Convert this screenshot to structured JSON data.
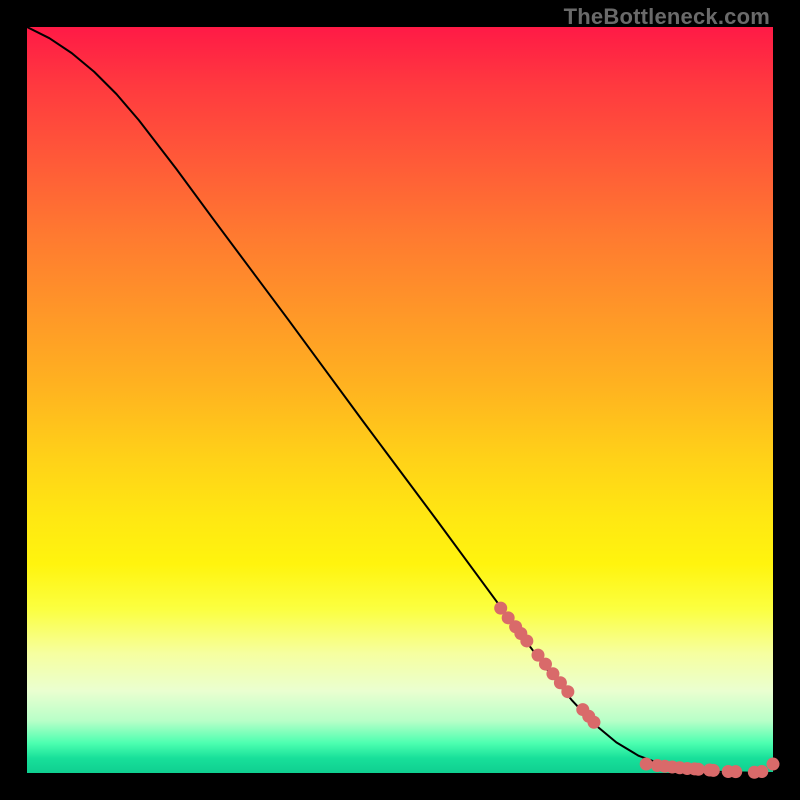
{
  "watermark": "TheBottleneck.com",
  "chart_data": {
    "type": "line",
    "title": "",
    "xlabel": "",
    "ylabel": "",
    "xlim": [
      0,
      100
    ],
    "ylim": [
      0,
      100
    ],
    "grid": false,
    "legend": false,
    "series": [
      {
        "name": "curve",
        "style": "line",
        "color": "#000000",
        "x": [
          0,
          3,
          6,
          9,
          12,
          15,
          20,
          25,
          30,
          35,
          40,
          45,
          50,
          55,
          60,
          65,
          70,
          73,
          76,
          79,
          82,
          85,
          88,
          91,
          94,
          97,
          100
        ],
        "y": [
          100,
          98.5,
          96.5,
          94,
          91,
          87.5,
          81,
          74.2,
          67.5,
          60.8,
          54,
          47.2,
          40.5,
          33.8,
          27,
          20.2,
          13.5,
          9.8,
          6.6,
          4.1,
          2.3,
          1.2,
          0.55,
          0.25,
          0.1,
          0.05,
          0.0
        ]
      },
      {
        "name": "scatter-steep",
        "style": "scatter",
        "color": "#d96a6a",
        "x": [
          63.5,
          64.5,
          65.5,
          66.2,
          67.0,
          68.5,
          69.5,
          70.5,
          71.5,
          72.5,
          74.5,
          75.3,
          76.0
        ],
        "y": [
          22.1,
          20.8,
          19.6,
          18.7,
          17.7,
          15.8,
          14.6,
          13.3,
          12.1,
          10.9,
          8.5,
          7.6,
          6.8
        ]
      },
      {
        "name": "scatter-flat",
        "style": "scatter",
        "color": "#d96a6a",
        "x": [
          83.0,
          84.5,
          85.5,
          86.5,
          87.5,
          88.5,
          89.5,
          90.0,
          91.5,
          92.0,
          94.0,
          95.0,
          97.5,
          98.5,
          100.0
        ],
        "y": [
          1.2,
          1.0,
          0.9,
          0.8,
          0.7,
          0.6,
          0.55,
          0.5,
          0.4,
          0.35,
          0.2,
          0.18,
          0.1,
          0.2,
          1.2
        ]
      }
    ]
  }
}
